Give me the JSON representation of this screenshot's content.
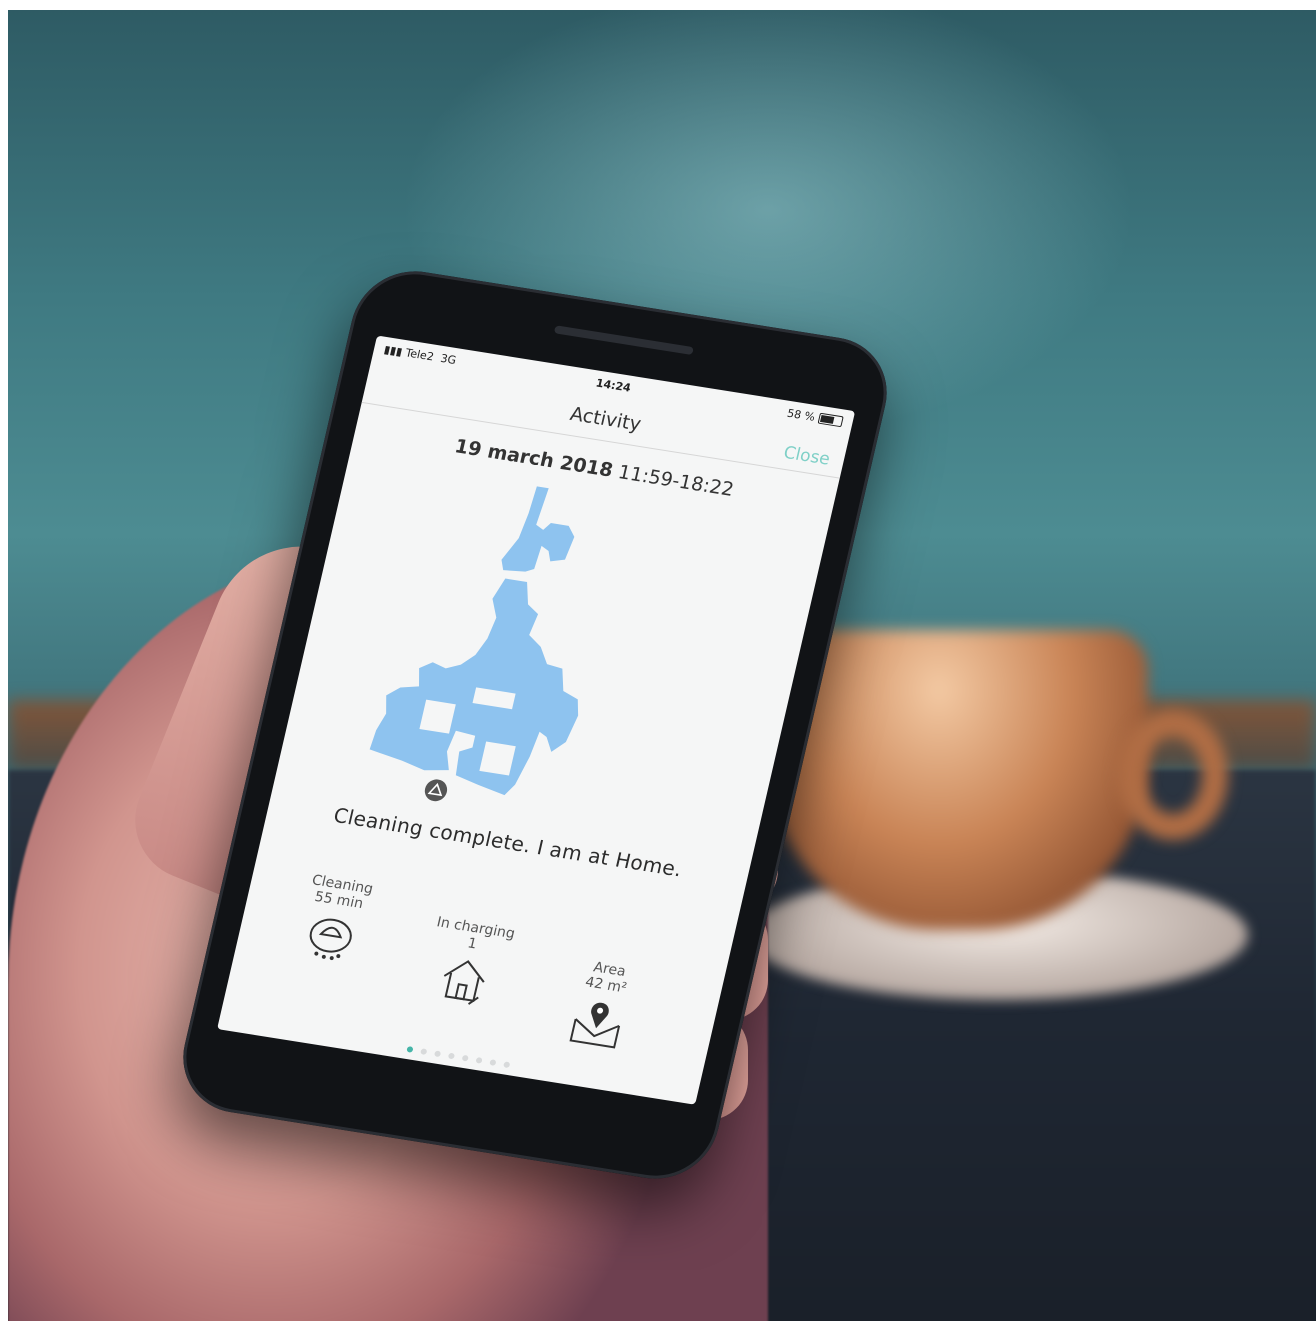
{
  "status_bar": {
    "carrier": "Tele2",
    "network": "3G",
    "time": "14:24",
    "battery": "58 %",
    "battery_level": 0.58
  },
  "header": {
    "title": "Activity",
    "close_label": "Close"
  },
  "session": {
    "date": "19 march 2018",
    "time_range": "11:59-18:22"
  },
  "message": "Cleaning complete. I am at Home.",
  "stats": [
    {
      "label": "Cleaning",
      "value": "55 min",
      "icon": "robot-cleaner-icon"
    },
    {
      "label": "In charging",
      "value": "1",
      "icon": "home-charging-icon"
    },
    {
      "label": "Area",
      "value": "42 m²",
      "icon": "map-pin-envelope-icon"
    }
  ],
  "pagination": {
    "total": 8,
    "active": 0
  },
  "colors": {
    "accent": "#7fd0c7",
    "map_fill": "#8ec3ef",
    "active_dot": "#45b5a8"
  }
}
